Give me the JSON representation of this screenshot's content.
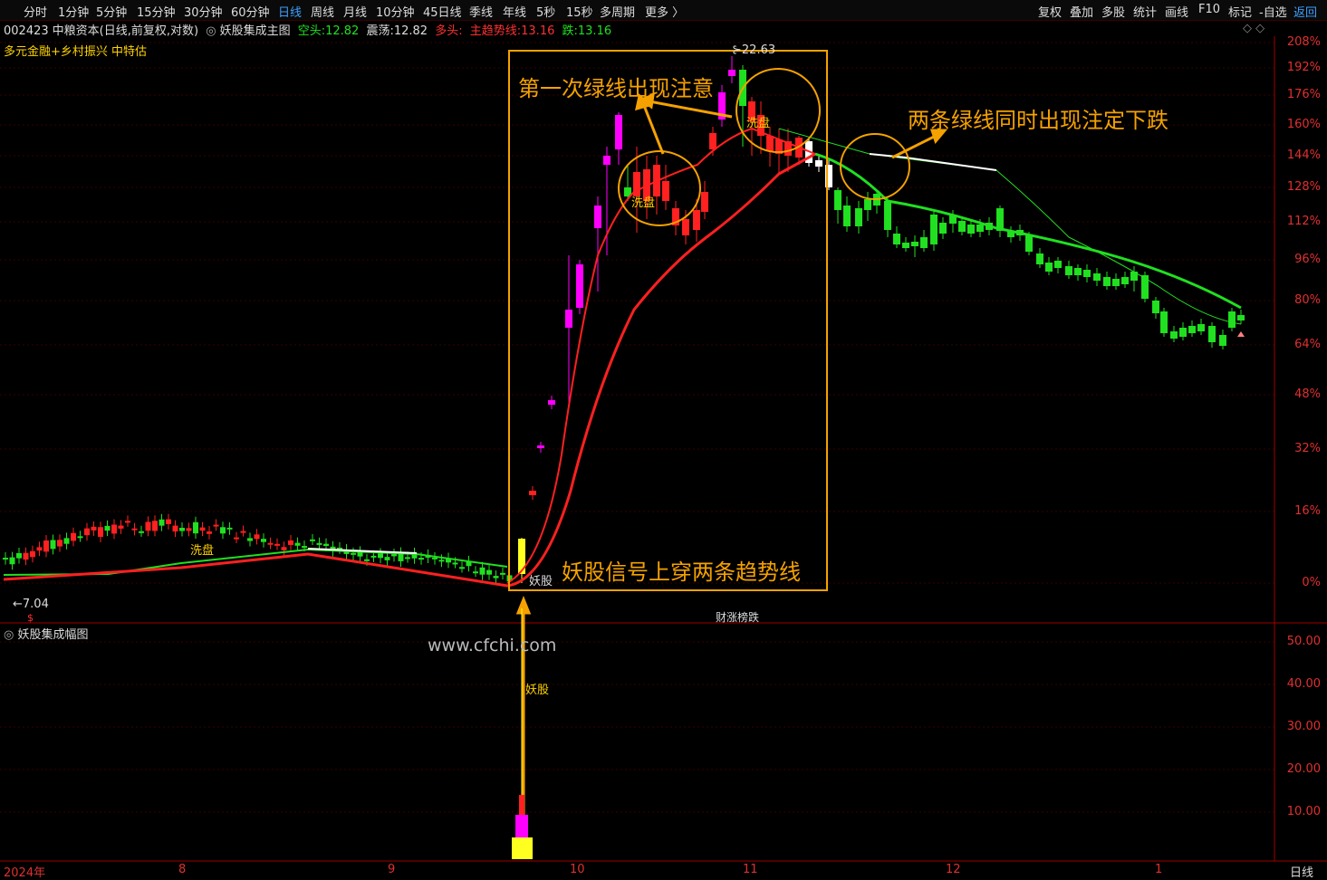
{
  "toolbar": {
    "left_items": [
      "分时",
      "1分钟",
      "5分钟",
      "15分钟",
      "30分钟",
      "60分钟",
      "日线",
      "周线",
      "月线",
      "10分钟",
      "45日线",
      "季线",
      "年线",
      "5秒",
      "15秒",
      "多周期",
      "更多 〉"
    ],
    "active": "日线",
    "right_items": [
      "复权",
      "叠加",
      "多股",
      "统计",
      "画线",
      "F10",
      "标记",
      "-自选",
      "返回"
    ]
  },
  "info": {
    "code": "002423",
    "name": "中粮资本",
    "mode": "(日线,前复权,对数)",
    "indicator": "妖股集成主图",
    "kongtou_label": "空头:",
    "kongtou_value": "12.82",
    "zhendang_label": "震荡:",
    "zhendang_value": "12.82",
    "duotou_label": "多头:",
    "trend_label": "主趋势线:",
    "trend_value": "13.16",
    "die_label": "跌:",
    "die_value": "13.16"
  },
  "tagline": "多元金融+乡村振兴 中特估",
  "subchart_title": "妖股集成幅图",
  "watermark": "www.cfchi.com",
  "annotations": {
    "first_green": "第一次绿线出现注意",
    "two_green": "两条绿线同时出现注定下跌",
    "signal_cross": "妖股信号上穿两条趋势线",
    "wash1": "洗盘",
    "wash2": "洗盘",
    "wash3": "洗盘",
    "yaogu1": "妖股",
    "yaogu2": "妖股",
    "low_price": "←7.04",
    "high_price": "22.63",
    "caizhang": "财涨榜跌"
  },
  "colors": {
    "up": "#ff2020",
    "down": "#20e020",
    "magenta": "#ff00ff",
    "yellow": "#ffff20",
    "frame": "#f5a200",
    "axis": "#e03030"
  },
  "chart_data": {
    "type": "candlestick",
    "y_axis_labels": [
      "208%",
      "192%",
      "176%",
      "160%",
      "144%",
      "128%",
      "112%",
      "96%",
      "80%",
      "64%",
      "48%",
      "32%",
      "16%",
      "0%"
    ],
    "sub_axis_labels": [
      "50.00",
      "40.00",
      "30.00",
      "20.00",
      "10.00"
    ],
    "x_axis_labels": [
      "2024年",
      "8",
      "9",
      "10",
      "11",
      "12",
      "1"
    ],
    "bottom_right": "日线",
    "low": 7.04,
    "high": 22.63
  }
}
